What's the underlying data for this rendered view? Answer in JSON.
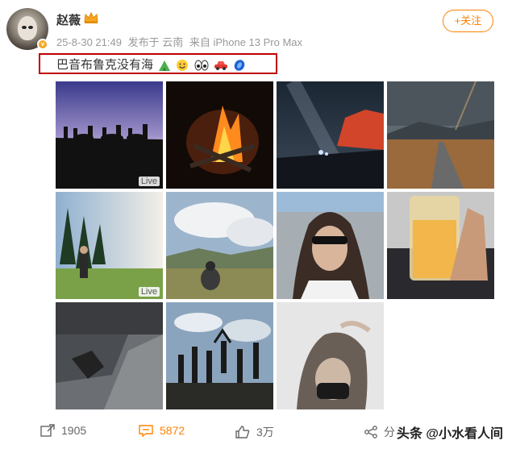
{
  "user": {
    "name": "赵薇",
    "time": "25-8-30 21:49",
    "location": "发布于 云南",
    "device": "来自 iPhone 13 Pro Max"
  },
  "follow_label": "+关注",
  "post": {
    "text": "巴音布鲁克没有海",
    "emojis": [
      "tent-icon",
      "smile-icon",
      "eyes-icon",
      "car-icon",
      "blue-stone-icon"
    ]
  },
  "photos": [
    {
      "label": "Live",
      "alt": "silhouettes on horses at sunset"
    },
    {
      "label": "",
      "alt": "campfire at night"
    },
    {
      "label": "",
      "alt": "milky way over red rocks"
    },
    {
      "label": "",
      "alt": "road through grassland with rainbow"
    },
    {
      "label": "Live",
      "alt": "person in forest meadow"
    },
    {
      "label": "",
      "alt": "person sitting on hill"
    },
    {
      "label": "",
      "alt": "woman with sunglasses"
    },
    {
      "label": "",
      "alt": "hand holding drink cup"
    },
    {
      "label": "",
      "alt": "car interior shadow"
    },
    {
      "label": "",
      "alt": "people jumping silhouettes"
    },
    {
      "label": "",
      "alt": "woman hair blowing"
    }
  ],
  "actions": {
    "share_count": "1905",
    "comment_count": "5872",
    "like_count": "3万",
    "forward_label": "分享"
  },
  "watermark": "头条 @小水看人间",
  "colors": {
    "accent": "#ff8200",
    "highlight_box": "#c00000",
    "comment_color": "#ff8200"
  }
}
